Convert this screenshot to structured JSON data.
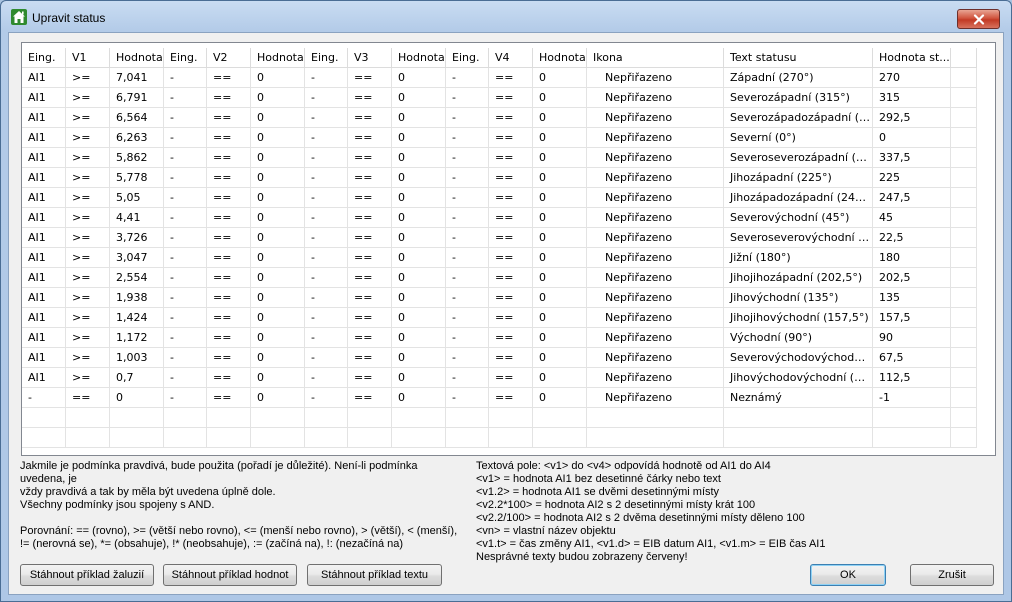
{
  "window": {
    "title": "Upravit status"
  },
  "table": {
    "headers": [
      "Eing.",
      "V1",
      "Hodnota",
      "Eing.",
      "V2",
      "Hodnota",
      "Eing.",
      "V3",
      "Hodnota",
      "Eing.",
      "V4",
      "Hodnota",
      "Ikona",
      "Text statusu",
      "Hodnota st...",
      ""
    ],
    "rows": [
      [
        "AI1",
        ">=",
        "7,041",
        "-",
        "==",
        "0",
        "-",
        "==",
        "0",
        "-",
        "==",
        "0",
        "Nepřiřazeno",
        "Západní (270°)",
        "270"
      ],
      [
        "AI1",
        ">=",
        "6,791",
        "-",
        "==",
        "0",
        "-",
        "==",
        "0",
        "-",
        "==",
        "0",
        "Nepřiřazeno",
        "Severozápadní (315°)",
        "315"
      ],
      [
        "AI1",
        ">=",
        "6,564",
        "-",
        "==",
        "0",
        "-",
        "==",
        "0",
        "-",
        "==",
        "0",
        "Nepřiřazeno",
        "Severozápadozápadní (2...",
        "292,5"
      ],
      [
        "AI1",
        ">=",
        "6,263",
        "-",
        "==",
        "0",
        "-",
        "==",
        "0",
        "-",
        "==",
        "0",
        "Nepřiřazeno",
        "Severní (0°)",
        "0"
      ],
      [
        "AI1",
        ">=",
        "5,862",
        "-",
        "==",
        "0",
        "-",
        "==",
        "0",
        "-",
        "==",
        "0",
        "Nepřiřazeno",
        "Severoseverozápadní (3...",
        "337,5"
      ],
      [
        "AI1",
        ">=",
        "5,778",
        "-",
        "==",
        "0",
        "-",
        "==",
        "0",
        "-",
        "==",
        "0",
        "Nepřiřazeno",
        "Jihozápadní (225°)",
        "225"
      ],
      [
        "AI1",
        ">=",
        "5,05",
        "-",
        "==",
        "0",
        "-",
        "==",
        "0",
        "-",
        "==",
        "0",
        "Nepřiřazeno",
        "Jihozápadozápadní (247,...",
        "247,5"
      ],
      [
        "AI1",
        ">=",
        "4,41",
        "-",
        "==",
        "0",
        "-",
        "==",
        "0",
        "-",
        "==",
        "0",
        "Nepřiřazeno",
        "Severovýchodní (45°)",
        "45"
      ],
      [
        "AI1",
        ">=",
        "3,726",
        "-",
        "==",
        "0",
        "-",
        "==",
        "0",
        "-",
        "==",
        "0",
        "Nepřiřazeno",
        "Severoseverovýchodní (...",
        "22,5"
      ],
      [
        "AI1",
        ">=",
        "3,047",
        "-",
        "==",
        "0",
        "-",
        "==",
        "0",
        "-",
        "==",
        "0",
        "Nepřiřazeno",
        "Jižní (180°)",
        "180"
      ],
      [
        "AI1",
        ">=",
        "2,554",
        "-",
        "==",
        "0",
        "-",
        "==",
        "0",
        "-",
        "==",
        "0",
        "Nepřiřazeno",
        "Jihojihozápadní (202,5°)",
        "202,5"
      ],
      [
        "AI1",
        ">=",
        "1,938",
        "-",
        "==",
        "0",
        "-",
        "==",
        "0",
        "-",
        "==",
        "0",
        "Nepřiřazeno",
        "Jihovýchodní (135°)",
        "135"
      ],
      [
        "AI1",
        ">=",
        "1,424",
        "-",
        "==",
        "0",
        "-",
        "==",
        "0",
        "-",
        "==",
        "0",
        "Nepřiřazeno",
        "Jihojihovýchodní (157,5°)",
        "157,5"
      ],
      [
        "AI1",
        ">=",
        "1,172",
        "-",
        "==",
        "0",
        "-",
        "==",
        "0",
        "-",
        "==",
        "0",
        "Nepřiřazeno",
        "Východní (90°)",
        "90"
      ],
      [
        "AI1",
        ">=",
        "1,003",
        "-",
        "==",
        "0",
        "-",
        "==",
        "0",
        "-",
        "==",
        "0",
        "Nepřiřazeno",
        "Severovýchodovýchodní ...",
        "67,5"
      ],
      [
        "AI1",
        ">=",
        "0,7",
        "-",
        "==",
        "0",
        "-",
        "==",
        "0",
        "-",
        "==",
        "0",
        "Nepřiřazeno",
        "Jihovýchodovýchodní (11...",
        "112,5"
      ],
      [
        "-",
        "==",
        "0",
        "-",
        "==",
        "0",
        "-",
        "==",
        "0",
        "-",
        "==",
        "0",
        "Nepřiřazeno",
        "Neznámý",
        "-1"
      ]
    ],
    "empty_rows": 2
  },
  "help_left": [
    "Jakmile je podmínka pravdivá, bude použita (pořadí je důležité). Není-li podmínka uvedena, je",
    "vždy pravdivá a tak by měla být uvedena úplně dole.",
    "Všechny podmínky jsou spojeny s AND.",
    "",
    "Porovnání: == (rovno), >= (větší nebo rovno), <= (menší nebo rovno), > (větší), < (menší),",
    "!= (nerovná se), *= (obsahuje), !* (neobsahuje), := (začíná na), !: (nezačíná na)"
  ],
  "help_right": [
    "Textová pole: <v1> do <v4> odpovídá hodnotě od AI1 do AI4",
    "<v1> = hodnota AI1 bez desetinné čárky nebo text",
    "<v1.2> = hodnota AI1 se dvěmi desetinnými místy",
    "<v2.2*100> = hodnota AI2 s 2 desetinnými místy krát 100",
    "<v2.2/100> = hodnota AI2 s 2 dvěma desetinnými místy děleno 100",
    "<vn> = vlastní název objektu",
    "<v1.t> = čas změny AI1, <v1.d> = EIB datum AI1, <v1.m> = EIB čas AI1",
    "Nesprávné texty budou zobrazeny červeny!"
  ],
  "buttons": {
    "download_blinds": "Stáhnout příklad žaluzií",
    "download_values": "Stáhnout příklad hodnot",
    "download_text": "Stáhnout příklad textu",
    "ok": "OK",
    "cancel": "Zrušit"
  },
  "colors": {
    "title_bar": "#b3cbe8",
    "close_button": "#c23a25",
    "dialog_bg": "#f0f0f0",
    "grid_line": "#e3e3e3"
  }
}
